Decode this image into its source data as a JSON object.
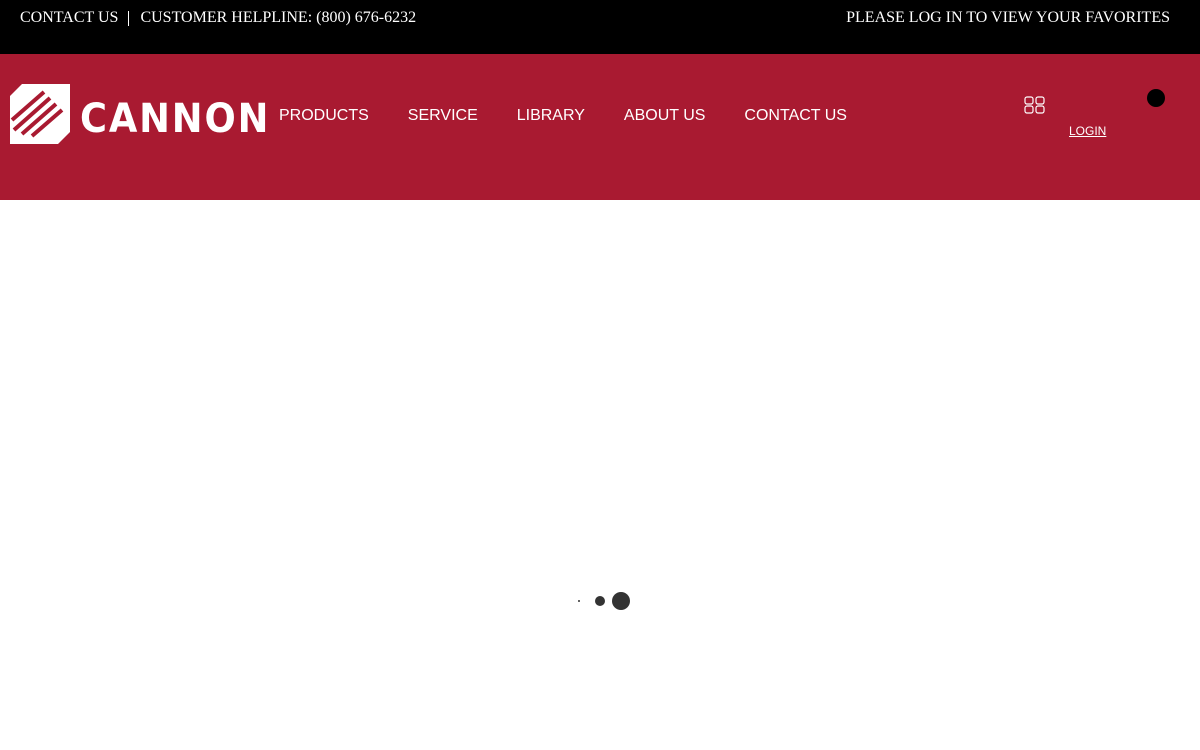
{
  "topbar": {
    "contact_label": "CONTACT US",
    "helpline_label": "CUSTOMER HELPLINE: (800) 676-6232",
    "favorites_notice": "PLEASE LOG IN TO VIEW YOUR FAVORITES"
  },
  "brand": {
    "name": "CANNON",
    "accent_color": "#a91a31",
    "topbar_color": "#000000"
  },
  "nav": {
    "items": [
      {
        "label": "PRODUCTS"
      },
      {
        "label": "SERVICE"
      },
      {
        "label": "LIBRARY"
      },
      {
        "label": "ABOUT US"
      },
      {
        "label": "CONTACT US"
      }
    ]
  },
  "header_actions": {
    "grid_icon": "grid-icon",
    "login_label": "LOGIN",
    "cart_icon": "cart-badge-icon"
  },
  "content": {
    "loading_indicator": "loading-dots-icon"
  }
}
